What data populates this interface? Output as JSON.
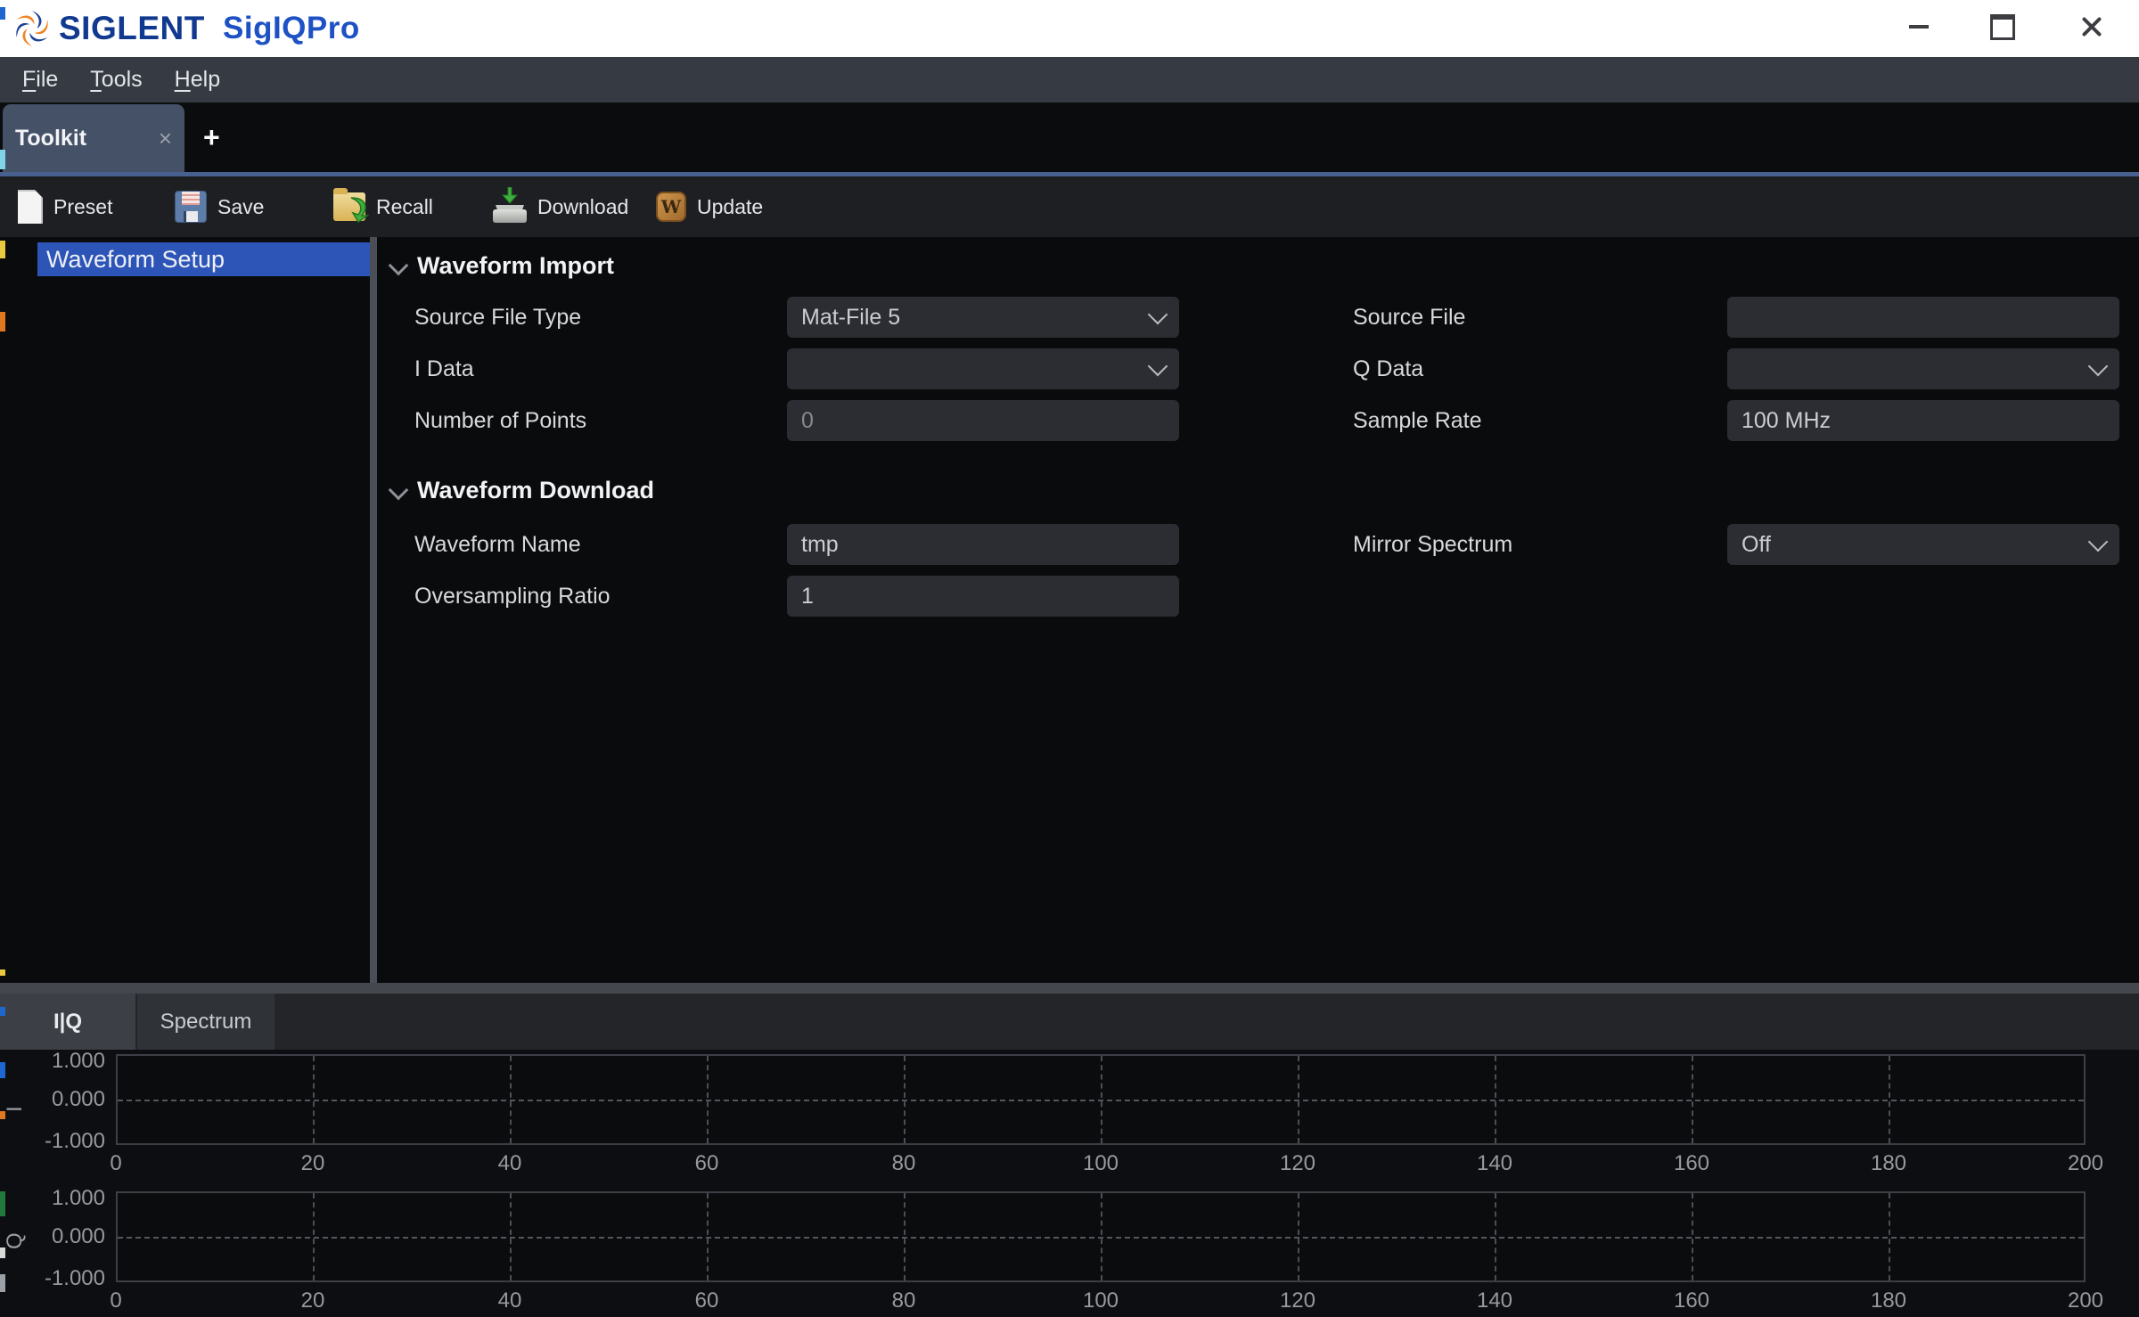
{
  "window": {
    "brand": "SIGLENT",
    "app": "SigIQPro"
  },
  "menu": {
    "items": [
      "File",
      "Tools",
      "Help"
    ]
  },
  "tabs": {
    "items": [
      {
        "label": "Toolkit",
        "active": true,
        "close_glyph": "×"
      }
    ],
    "add_label": "+"
  },
  "toolbar": {
    "items": [
      {
        "label": "Preset",
        "icon": "new-file-icon"
      },
      {
        "label": "Save",
        "icon": "save-floppy-icon"
      },
      {
        "label": "Recall",
        "icon": "recall-folder-icon"
      },
      {
        "label": "Download",
        "icon": "download-drive-icon"
      },
      {
        "label": "Update",
        "icon": "update-w-icon",
        "icon_letter": "W"
      }
    ]
  },
  "sidebar": {
    "items": [
      {
        "label": "Waveform Setup",
        "selected": true
      }
    ]
  },
  "form": {
    "sections": [
      {
        "title": "Waveform Import",
        "fields": [
          {
            "label": "Source File Type",
            "value": "Mat-File 5",
            "control": "select",
            "col": 1,
            "row": 1
          },
          {
            "label": "Source File",
            "value": "",
            "control": "input",
            "col": 2,
            "row": 1
          },
          {
            "label": "I Data",
            "value": "",
            "control": "select",
            "col": 1,
            "row": 2
          },
          {
            "label": "Q Data",
            "value": "",
            "control": "select",
            "col": 2,
            "row": 2
          },
          {
            "label": "Number of Points",
            "value": "0",
            "control": "input",
            "disabled": true,
            "col": 1,
            "row": 3
          },
          {
            "label": "Sample Rate",
            "value": "100 MHz",
            "control": "input",
            "col": 2,
            "row": 3
          }
        ]
      },
      {
        "title": "Waveform Download",
        "fields": [
          {
            "label": "Waveform Name",
            "value": "tmp",
            "control": "input",
            "col": 1,
            "row": 1
          },
          {
            "label": "Mirror Spectrum",
            "value": "Off",
            "control": "select",
            "col": 2,
            "row": 1
          },
          {
            "label": "Oversampling Ratio",
            "value": "1",
            "control": "input",
            "col": 1,
            "row": 2
          }
        ]
      }
    ]
  },
  "bottom_tabs": {
    "items": [
      {
        "label": "I|Q",
        "active": true
      },
      {
        "label": "Spectrum",
        "active": false
      }
    ]
  },
  "chart_data": [
    {
      "type": "line",
      "axis_label": "I",
      "x_ticks": [
        0,
        20,
        40,
        60,
        80,
        100,
        120,
        140,
        160,
        180,
        200
      ],
      "y_tick_labels": [
        "1.000",
        "0.000",
        "-1.000"
      ],
      "xlim": [
        0,
        200
      ],
      "ylim": [
        -1,
        1
      ],
      "grid": "dashed",
      "legend": "none",
      "series": [
        {
          "name": "I",
          "x": [],
          "y": []
        }
      ]
    },
    {
      "type": "line",
      "axis_label": "Q",
      "x_ticks": [
        0,
        20,
        40,
        60,
        80,
        100,
        120,
        140,
        160,
        180,
        200
      ],
      "y_tick_labels": [
        "1.000",
        "0.000",
        "-1.000"
      ],
      "xlim": [
        0,
        200
      ],
      "ylim": [
        -1,
        1
      ],
      "grid": "dashed",
      "legend": "none",
      "series": [
        {
          "name": "Q",
          "x": [],
          "y": []
        }
      ]
    }
  ],
  "colors": {
    "brand_navy": "#10398f",
    "brand_blue": "#1e51c4",
    "logo_orange": "#f08424",
    "accent_line": "#47608f",
    "selection_blue": "#2d55b8",
    "field_bg": "#2b2d32",
    "menubar_bg": "#363b43"
  }
}
